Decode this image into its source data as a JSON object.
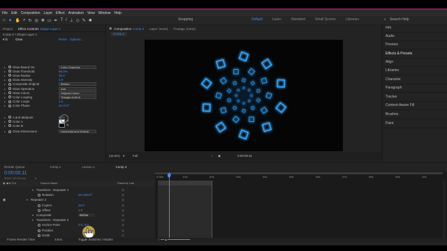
{
  "menu": [
    "File",
    "Edit",
    "Composition",
    "Layer",
    "Effect",
    "Animation",
    "View",
    "Window",
    "Help"
  ],
  "toolbar": {
    "snapping_label": "Snapping",
    "workspaces": [
      "Default",
      "Learn",
      "Standard",
      "Small Screen",
      "Libraries"
    ],
    "search_label": "Search Help"
  },
  "project_panel": {
    "tabs": [
      "Project",
      "Effect Controls",
      "Shape Layer 1"
    ],
    "layer_path": "Comp 4 • Shape Layer 1",
    "effect_name": "Glow",
    "reset_label": "Reset",
    "options_label": "Options...",
    "properties": [
      {
        "name": "Glow Based On",
        "value": "Color Channels",
        "type": "dropdown"
      },
      {
        "name": "Glow Threshold",
        "value": "60.0%",
        "type": "value"
      },
      {
        "name": "Glow Radius",
        "value": "30.0",
        "type": "value"
      },
      {
        "name": "Glow Intensity",
        "value": "2.0",
        "type": "value"
      },
      {
        "name": "Composite Original",
        "value": "Behind",
        "type": "dropdown"
      },
      {
        "name": "Glow Operation",
        "value": "Add",
        "type": "dropdown"
      },
      {
        "name": "Glow Colors",
        "value": "Original Colors",
        "type": "dropdown"
      },
      {
        "name": "Color Looping",
        "value": "Triangle A>B>A",
        "type": "dropdown"
      },
      {
        "name": "Color Loops",
        "value": "1.0",
        "type": "value"
      },
      {
        "name": "Color Phase",
        "value": "0x+0.0°",
        "type": "value"
      },
      {
        "name": "A & B Midpoint",
        "value": "50%",
        "type": "value"
      },
      {
        "name": "Color A",
        "value": "",
        "type": "swatch"
      },
      {
        "name": "Color B",
        "value": "",
        "type": "swatch"
      },
      {
        "name": "Glow Dimensions",
        "value": "Horizontal and Vertical",
        "type": "dropdown"
      }
    ]
  },
  "composition_panel": {
    "tabs": [
      "Composition",
      "Comp 4",
      "Layer",
      "(none)",
      "Footage",
      "(none)"
    ],
    "sub_tab": "Comp 4",
    "zoom": "(44.5%)",
    "resolution": "Full",
    "timecode": "0:00:00:11"
  },
  "right_panel": {
    "items": [
      "Info",
      "Audio",
      "Preview",
      "Effects & Presets",
      "Align",
      "Libraries",
      "Character",
      "Paragraph",
      "Tracker",
      "Content-Aware Fill",
      "Brushes",
      "Paint"
    ]
  },
  "timeline": {
    "tabs": [
      "Render Queue",
      "Comp 1",
      "Lesson 1",
      "Comp 4"
    ],
    "timecode": "0:00:00:11",
    "header_source": "Source Name",
    "header_parent": "Parent & Link",
    "rows": [
      {
        "indent": 2,
        "name": "Transform : Repeater 1",
        "value": ""
      },
      {
        "indent": 3,
        "name": "Rotation",
        "value": "0x+180.0°"
      },
      {
        "indent": 1,
        "name": "Repeater 2",
        "value": ""
      },
      {
        "indent": 3,
        "name": "Copies",
        "value": "23.0"
      },
      {
        "indent": 3,
        "name": "Offset",
        "value": "1.0"
      },
      {
        "indent": 2,
        "name": "Composite",
        "value": "Below"
      },
      {
        "indent": 2,
        "name": "Transform : Repeater 2",
        "value": ""
      },
      {
        "indent": 3,
        "name": "Anchor Point",
        "value": "0.0, 0.0"
      },
      {
        "indent": 3,
        "name": "Position",
        "value": ""
      },
      {
        "indent": 3,
        "name": "Scale",
        "value": ""
      }
    ],
    "ruler": [
      "0:00s",
      "01s",
      "02s",
      "03s",
      "04s",
      "05s",
      "06s",
      "07s",
      "08s",
      "09s",
      "10s"
    ],
    "footer_left": "Frame Render Time",
    "footer_time": "44ms",
    "footer_toggle": "Toggle Switches / Modes"
  },
  "colors": {
    "accent": "#3d8ef6",
    "glow": "#3aa8ff",
    "playhead": "#4a8df0"
  }
}
